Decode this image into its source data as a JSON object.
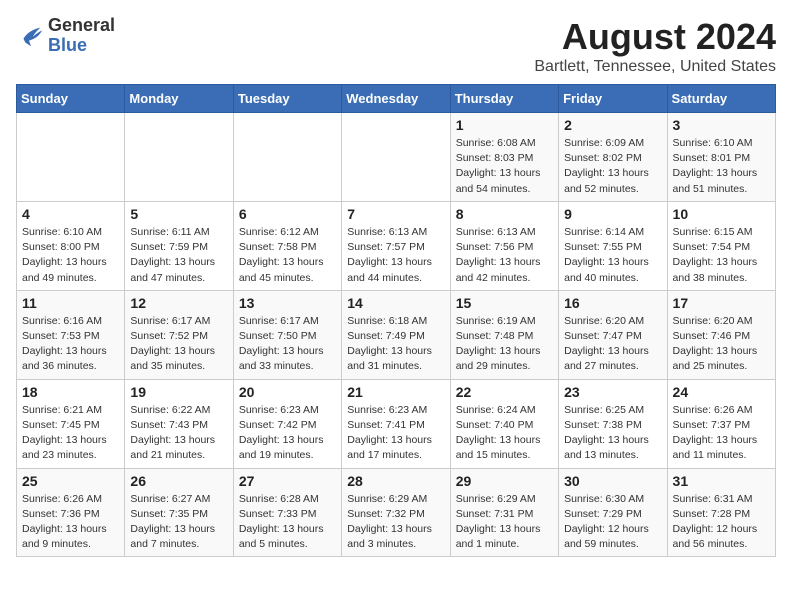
{
  "header": {
    "logo": {
      "line1": "General",
      "line2": "Blue"
    },
    "title": "August 2024",
    "subtitle": "Bartlett, Tennessee, United States"
  },
  "calendar": {
    "weekdays": [
      "Sunday",
      "Monday",
      "Tuesday",
      "Wednesday",
      "Thursday",
      "Friday",
      "Saturday"
    ],
    "weeks": [
      [
        {
          "day": "",
          "info": ""
        },
        {
          "day": "",
          "info": ""
        },
        {
          "day": "",
          "info": ""
        },
        {
          "day": "",
          "info": ""
        },
        {
          "day": "1",
          "info": "Sunrise: 6:08 AM\nSunset: 8:03 PM\nDaylight: 13 hours\nand 54 minutes."
        },
        {
          "day": "2",
          "info": "Sunrise: 6:09 AM\nSunset: 8:02 PM\nDaylight: 13 hours\nand 52 minutes."
        },
        {
          "day": "3",
          "info": "Sunrise: 6:10 AM\nSunset: 8:01 PM\nDaylight: 13 hours\nand 51 minutes."
        }
      ],
      [
        {
          "day": "4",
          "info": "Sunrise: 6:10 AM\nSunset: 8:00 PM\nDaylight: 13 hours\nand 49 minutes."
        },
        {
          "day": "5",
          "info": "Sunrise: 6:11 AM\nSunset: 7:59 PM\nDaylight: 13 hours\nand 47 minutes."
        },
        {
          "day": "6",
          "info": "Sunrise: 6:12 AM\nSunset: 7:58 PM\nDaylight: 13 hours\nand 45 minutes."
        },
        {
          "day": "7",
          "info": "Sunrise: 6:13 AM\nSunset: 7:57 PM\nDaylight: 13 hours\nand 44 minutes."
        },
        {
          "day": "8",
          "info": "Sunrise: 6:13 AM\nSunset: 7:56 PM\nDaylight: 13 hours\nand 42 minutes."
        },
        {
          "day": "9",
          "info": "Sunrise: 6:14 AM\nSunset: 7:55 PM\nDaylight: 13 hours\nand 40 minutes."
        },
        {
          "day": "10",
          "info": "Sunrise: 6:15 AM\nSunset: 7:54 PM\nDaylight: 13 hours\nand 38 minutes."
        }
      ],
      [
        {
          "day": "11",
          "info": "Sunrise: 6:16 AM\nSunset: 7:53 PM\nDaylight: 13 hours\nand 36 minutes."
        },
        {
          "day": "12",
          "info": "Sunrise: 6:17 AM\nSunset: 7:52 PM\nDaylight: 13 hours\nand 35 minutes."
        },
        {
          "day": "13",
          "info": "Sunrise: 6:17 AM\nSunset: 7:50 PM\nDaylight: 13 hours\nand 33 minutes."
        },
        {
          "day": "14",
          "info": "Sunrise: 6:18 AM\nSunset: 7:49 PM\nDaylight: 13 hours\nand 31 minutes."
        },
        {
          "day": "15",
          "info": "Sunrise: 6:19 AM\nSunset: 7:48 PM\nDaylight: 13 hours\nand 29 minutes."
        },
        {
          "day": "16",
          "info": "Sunrise: 6:20 AM\nSunset: 7:47 PM\nDaylight: 13 hours\nand 27 minutes."
        },
        {
          "day": "17",
          "info": "Sunrise: 6:20 AM\nSunset: 7:46 PM\nDaylight: 13 hours\nand 25 minutes."
        }
      ],
      [
        {
          "day": "18",
          "info": "Sunrise: 6:21 AM\nSunset: 7:45 PM\nDaylight: 13 hours\nand 23 minutes."
        },
        {
          "day": "19",
          "info": "Sunrise: 6:22 AM\nSunset: 7:43 PM\nDaylight: 13 hours\nand 21 minutes."
        },
        {
          "day": "20",
          "info": "Sunrise: 6:23 AM\nSunset: 7:42 PM\nDaylight: 13 hours\nand 19 minutes."
        },
        {
          "day": "21",
          "info": "Sunrise: 6:23 AM\nSunset: 7:41 PM\nDaylight: 13 hours\nand 17 minutes."
        },
        {
          "day": "22",
          "info": "Sunrise: 6:24 AM\nSunset: 7:40 PM\nDaylight: 13 hours\nand 15 minutes."
        },
        {
          "day": "23",
          "info": "Sunrise: 6:25 AM\nSunset: 7:38 PM\nDaylight: 13 hours\nand 13 minutes."
        },
        {
          "day": "24",
          "info": "Sunrise: 6:26 AM\nSunset: 7:37 PM\nDaylight: 13 hours\nand 11 minutes."
        }
      ],
      [
        {
          "day": "25",
          "info": "Sunrise: 6:26 AM\nSunset: 7:36 PM\nDaylight: 13 hours\nand 9 minutes."
        },
        {
          "day": "26",
          "info": "Sunrise: 6:27 AM\nSunset: 7:35 PM\nDaylight: 13 hours\nand 7 minutes."
        },
        {
          "day": "27",
          "info": "Sunrise: 6:28 AM\nSunset: 7:33 PM\nDaylight: 13 hours\nand 5 minutes."
        },
        {
          "day": "28",
          "info": "Sunrise: 6:29 AM\nSunset: 7:32 PM\nDaylight: 13 hours\nand 3 minutes."
        },
        {
          "day": "29",
          "info": "Sunrise: 6:29 AM\nSunset: 7:31 PM\nDaylight: 13 hours\nand 1 minute."
        },
        {
          "day": "30",
          "info": "Sunrise: 6:30 AM\nSunset: 7:29 PM\nDaylight: 12 hours\nand 59 minutes."
        },
        {
          "day": "31",
          "info": "Sunrise: 6:31 AM\nSunset: 7:28 PM\nDaylight: 12 hours\nand 56 minutes."
        }
      ]
    ]
  }
}
